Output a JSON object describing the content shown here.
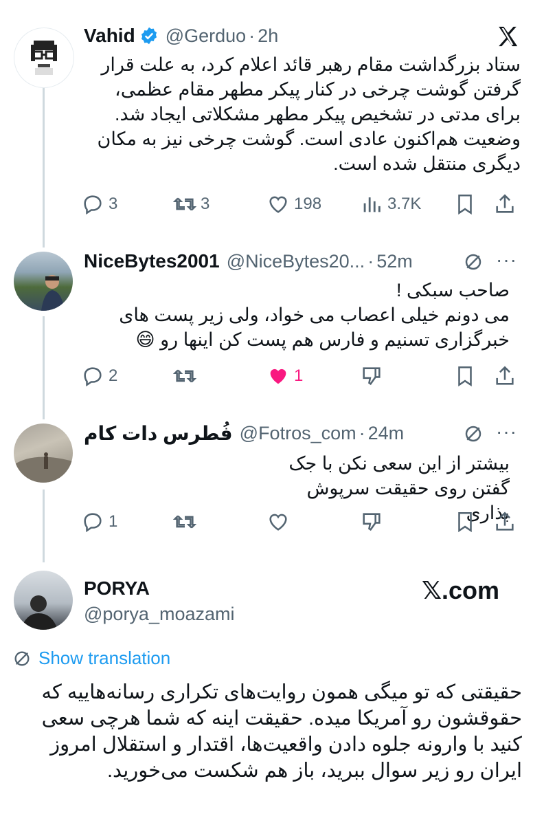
{
  "tweets": [
    {
      "name": "Vahid",
      "handle": "@Gerduo",
      "dot": "·",
      "time": "2h",
      "verified": true,
      "text": "ستاد بزرگداشت مقام رهبر قائد اعلام کرد، به علت قرار گرفتن گوشت چرخی در کنار پیکر مطهر مقام عظمی، برای مدتی در تشخیص پیکر مطهر مشکلاتی ایجاد شد. وضعیت هم‌اکنون عادی است. گوشت چرخی نیز به مکان دیگری منتقل شده است.",
      "replies": "3",
      "retweets": "3",
      "likes": "198",
      "views": "3.7K"
    },
    {
      "name": "NiceBytes2001",
      "handle": "@NiceBytes20...",
      "dot": "·",
      "time": "52m",
      "text_line1": "صاحب سبکی !",
      "text_line2": "می دونم خیلی اعصاب می خواد، ولی زیر پست های خبرگزاری تسنیم و فارس هم پست کن اینها رو 😄",
      "replies": "2",
      "likes": "1"
    },
    {
      "name": "فُطرس دات کام",
      "handle": "@Fotros_com",
      "dot": "·",
      "time": "24m",
      "text": "بیشتر از این سعی نکن با جک گفتن روی حقیقت سرپوش بذاری",
      "replies": "1"
    }
  ],
  "quoted": {
    "name": "PORYA",
    "handle": "@porya_moazami",
    "brand": "𝕏.com",
    "show_translation": "Show translation",
    "text": "حقیقتی که تو میگی همون روایت‌های تکراری رسانه‌هاییه که حقوقشون رو آمریکا میده. حقیقت اینه که شما هرچی سعی کنید با وارونه جلوه دادن واقعیت‌ها، اقتدار و استقلال امروز ایران رو زیر سوال ببرید، باز هم شکست می‌خورید."
  },
  "colors": {
    "verified": "#1d9bf0",
    "like": "#f91880",
    "muted": "#536471",
    "link": "#1d9bf0",
    "thread_line": "#cfd9de"
  },
  "icons": [
    "x-logo-icon",
    "verified-badge-icon",
    "reply-icon",
    "retweet-icon",
    "like-icon",
    "views-icon",
    "bookmark-icon",
    "share-icon",
    "translate-icon",
    "more-icon",
    "dislike-icon"
  ]
}
